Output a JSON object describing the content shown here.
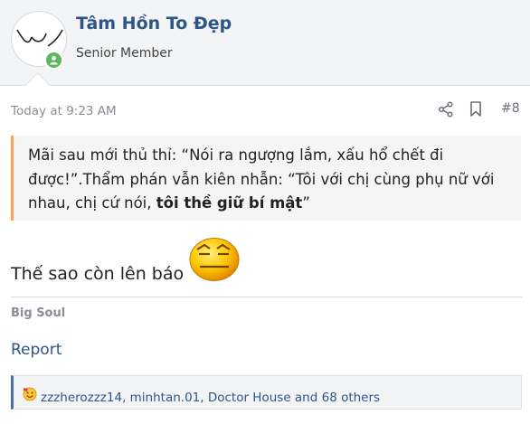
{
  "user": {
    "name": "Tâm Hồn To Đẹp",
    "title": "Senior Member"
  },
  "post": {
    "time": "Today at 9:23 AM",
    "number": "#8",
    "quote_line1": "Mãi sau mới thủ thỉ: “Nói ra ngượng lắm, xấu hổ chết đi",
    "quote_line2": "được!”.Thẩm phán vẫn kiên nhẫn: “Tôi với chị cùng phụ nữ với",
    "quote_line3_plain": "nhau, chị cứ nói, ",
    "quote_line3_bold": "tôi thề giữ bí mật",
    "quote_line3_end": "”",
    "body": "Thế sao còn lên báo",
    "signature": "Big Soul",
    "report_label": "Report",
    "reactions_text": "zzzherozzz14, minhtan.01, Doctor House and 68 others"
  },
  "colors": {
    "accent": "#2d5586",
    "quote_border": "#f7a456",
    "online": "#5cb85c"
  },
  "icons": [
    "share-icon",
    "bookmark-icon",
    "online-status-icon",
    "smiley-emoji",
    "reaction-emoji"
  ]
}
